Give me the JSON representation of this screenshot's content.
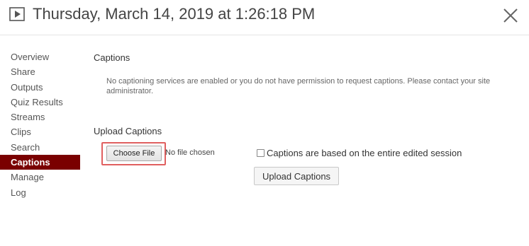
{
  "header": {
    "title": "Thursday, March 14, 2019 at 1:26:18 PM",
    "play_icon": "play-icon",
    "close_icon": "close-icon"
  },
  "sidebar": {
    "items": [
      {
        "label": "Overview",
        "active": false
      },
      {
        "label": "Share",
        "active": false
      },
      {
        "label": "Outputs",
        "active": false
      },
      {
        "label": "Quiz Results",
        "active": false
      },
      {
        "label": "Streams",
        "active": false
      },
      {
        "label": "Clips",
        "active": false
      },
      {
        "label": "Search",
        "active": false
      },
      {
        "label": "Captions",
        "active": true
      },
      {
        "label": "Manage",
        "active": false
      },
      {
        "label": "Log",
        "active": false
      }
    ],
    "active_color": "#7a0000"
  },
  "main": {
    "captions_title": "Captions",
    "captions_message": "No captioning services are enabled or you do not have permission to request captions. Please contact your site administrator.",
    "upload_title": "Upload Captions",
    "choose_file_label": "Choose File",
    "no_file_text": "No file chosen",
    "entire_session_label": "Captions are based on the entire edited session",
    "entire_session_checked": false,
    "upload_button_label": "Upload Captions",
    "highlight_color": "#e06060"
  }
}
